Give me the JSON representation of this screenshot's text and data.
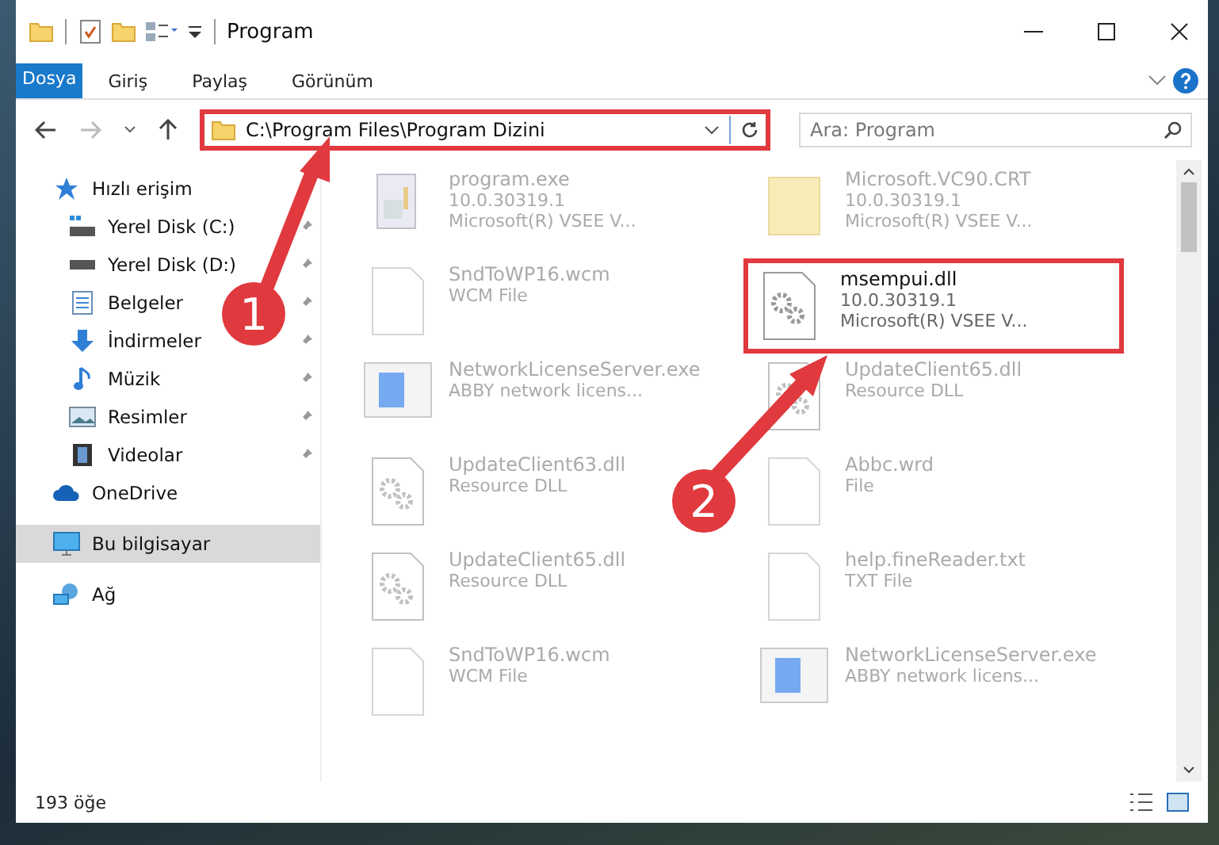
{
  "window": {
    "title": "Program"
  },
  "ribbon_tabs": [
    {
      "label": "Dosya",
      "kind": "file"
    },
    {
      "label": "Giriş",
      "kind": "tab"
    },
    {
      "label": "Paylaş",
      "kind": "tab"
    },
    {
      "label": "Görünüm",
      "kind": "tab"
    }
  ],
  "address": {
    "path": "C:\\Program Files\\Program Dizini",
    "highlighted": true
  },
  "search": {
    "placeholder": "Ara: Program"
  },
  "sidebar": {
    "items": [
      {
        "label": "Hızlı erişim",
        "kind": "star",
        "selected": false,
        "children": [
          {
            "label": "Yerel Disk (C:)",
            "kind": "drive-c",
            "pinned": true
          },
          {
            "label": "Yerel Disk (D:)",
            "kind": "drive",
            "pinned": true
          },
          {
            "label": "Belgeler",
            "kind": "document",
            "pinned": true
          },
          {
            "label": "İndirmeler",
            "kind": "download",
            "pinned": true
          },
          {
            "label": "Müzik",
            "kind": "music",
            "pinned": true
          },
          {
            "label": "Resimler",
            "kind": "picture",
            "pinned": true
          },
          {
            "label": "Videolar",
            "kind": "video",
            "pinned": true
          }
        ]
      },
      {
        "label": "OneDrive",
        "kind": "cloud",
        "selected": false
      },
      {
        "label": "Bu bilgisayar",
        "kind": "computer",
        "selected": true
      },
      {
        "label": "Ağ",
        "kind": "network",
        "selected": false
      }
    ]
  },
  "files": [
    {
      "name": "program.exe",
      "lines": [
        "10.0.30319.1",
        "Microsoft(R) VSEE V..."
      ],
      "kind": "exe",
      "faded": true,
      "highlighted": false
    },
    {
      "name": "Microsoft.VC90.CRT",
      "lines": [
        "10.0.30319.1",
        "Microsoft(R) VSEE V..."
      ],
      "kind": "folder",
      "faded": true,
      "highlighted": false
    },
    {
      "name": "SndToWP16.wcm",
      "lines": [
        "WCM File"
      ],
      "kind": "blank",
      "faded": true,
      "highlighted": false
    },
    {
      "name": "msempui.dll",
      "lines": [
        "10.0.30319.1",
        "Microsoft(R) VSEE V..."
      ],
      "kind": "dll",
      "faded": false,
      "highlighted": true
    },
    {
      "name": "NetworkLicenseServer.exe",
      "lines": [
        "ABBY network licens..."
      ],
      "kind": "app",
      "faded": true,
      "highlighted": false
    },
    {
      "name": "UpdateClient65.dll",
      "lines": [
        "Resource DLL"
      ],
      "kind": "dll",
      "faded": true,
      "highlighted": false
    },
    {
      "name": "UpdateClient63.dll",
      "lines": [
        "Resource DLL"
      ],
      "kind": "dll",
      "faded": true,
      "highlighted": false
    },
    {
      "name": "Abbc.wrd",
      "lines": [
        "File"
      ],
      "kind": "blank",
      "faded": true,
      "highlighted": false
    },
    {
      "name": "UpdateClient65.dll",
      "lines": [
        "Resource DLL"
      ],
      "kind": "dll",
      "faded": true,
      "highlighted": false
    },
    {
      "name": "help.fineReader.txt",
      "lines": [
        "TXT File"
      ],
      "kind": "blank",
      "faded": true,
      "highlighted": false
    },
    {
      "name": "SndToWP16.wcm",
      "lines": [
        "WCM File"
      ],
      "kind": "blank",
      "faded": true,
      "highlighted": false
    },
    {
      "name": "NetworkLicenseServer.exe",
      "lines": [
        "ABBY network licens..."
      ],
      "kind": "app",
      "faded": true,
      "highlighted": false
    }
  ],
  "status_bar": {
    "count": "193 öğe"
  },
  "annotations": [
    {
      "label": "1"
    },
    {
      "label": "2"
    }
  ]
}
